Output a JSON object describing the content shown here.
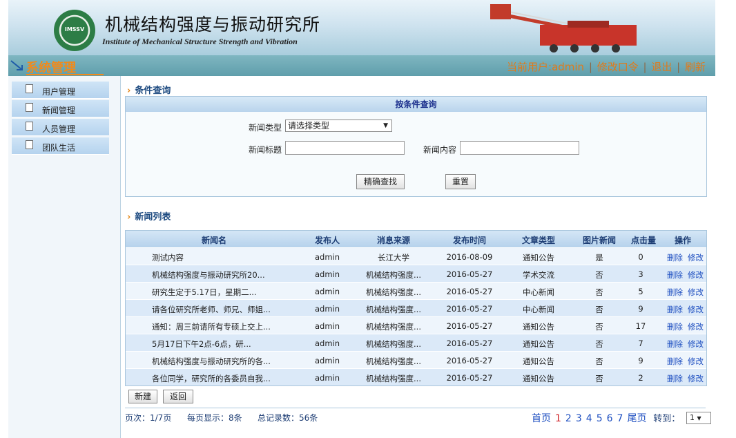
{
  "header": {
    "logo_text": "IMSSV",
    "title_cn": "机械结构强度与振动研究所",
    "title_en": "Institute of Mechanical Structure Strength and Vibration"
  },
  "nav": {
    "system_title": "系统管理",
    "current_user": "当前用户:admin",
    "change_password": "修改口令",
    "logout": "退出",
    "refresh": "刷新"
  },
  "sidebar": {
    "items": [
      {
        "label": "用户管理"
      },
      {
        "label": "新闻管理"
      },
      {
        "label": "人员管理"
      },
      {
        "label": "团队生活"
      }
    ]
  },
  "query": {
    "section_title": "条件查询",
    "box_title": "按条件查询",
    "type_label": "新闻类型",
    "type_value": "请选择类型",
    "title_label": "新闻标题",
    "content_label": "新闻内容",
    "search_button": "精确查找",
    "reset_button": "重置"
  },
  "list": {
    "section_title": "新闻列表",
    "headers": [
      "新闻名",
      "发布人",
      "消息来源",
      "发布时间",
      "文章类型",
      "图片新闻",
      "点击量",
      "操作"
    ],
    "rows": [
      {
        "name": "测试内容",
        "publisher": "admin",
        "source": "长江大学",
        "date": "2016-08-09",
        "type": "通知公告",
        "pic": "是",
        "clicks": "0"
      },
      {
        "name": "机械结构强度与振动研究所20...",
        "publisher": "admin",
        "source": "机械结构强度...",
        "date": "2016-05-27",
        "type": "学术交流",
        "pic": "否",
        "clicks": "3"
      },
      {
        "name": "研究生定于5.17日，星期二...",
        "publisher": "admin",
        "source": "机械结构强度...",
        "date": "2016-05-27",
        "type": "中心新闻",
        "pic": "否",
        "clicks": "5"
      },
      {
        "name": "请各位研究所老师、师兄、师姐...",
        "publisher": "admin",
        "source": "机械结构强度...",
        "date": "2016-05-27",
        "type": "中心新闻",
        "pic": "否",
        "clicks": "9"
      },
      {
        "name": "通知：周三前请所有专硕上交上...",
        "publisher": "admin",
        "source": "机械结构强度...",
        "date": "2016-05-27",
        "type": "通知公告",
        "pic": "否",
        "clicks": "17"
      },
      {
        "name": "5月17日下午2点-6点，研...",
        "publisher": "admin",
        "source": "机械结构强度...",
        "date": "2016-05-27",
        "type": "通知公告",
        "pic": "否",
        "clicks": "7"
      },
      {
        "name": "机械结构强度与振动研究所的各...",
        "publisher": "admin",
        "source": "机械结构强度...",
        "date": "2016-05-27",
        "type": "通知公告",
        "pic": "否",
        "clicks": "9"
      },
      {
        "name": "各位同学，研究所的各委员自我...",
        "publisher": "admin",
        "source": "机械结构强度...",
        "date": "2016-05-27",
        "type": "通知公告",
        "pic": "否",
        "clicks": "2"
      }
    ],
    "delete_label": "删除",
    "edit_label": "修改"
  },
  "actions": {
    "new_button": "新建",
    "back_button": "返回"
  },
  "footer": {
    "page_info": "页次：1/7页",
    "per_page": "每页显示：8条",
    "total": "总记录数：56条",
    "first": "首页",
    "pages": [
      "1",
      "2",
      "3",
      "4",
      "5",
      "6",
      "7"
    ],
    "current_page": "1",
    "last": "尾页",
    "goto_label": "转到：",
    "goto_value": "1"
  }
}
